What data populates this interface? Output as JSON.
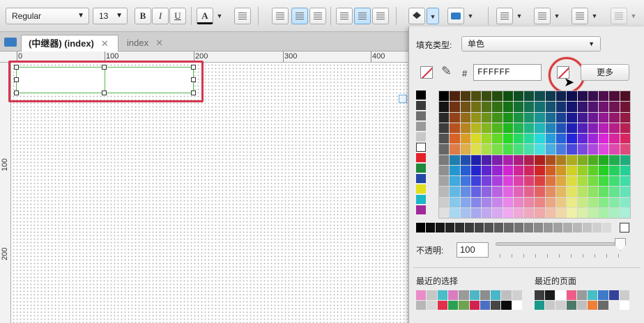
{
  "toolbar": {
    "font_family": "Regular",
    "font_size": "13",
    "bold": "B",
    "italic": "I",
    "underline": "U",
    "font_color": "A"
  },
  "tabs": [
    {
      "label": "(中继器) (index)",
      "active": true
    },
    {
      "label": "index",
      "active": false
    }
  ],
  "ruler": {
    "h_labels": [
      "0",
      "100",
      "200",
      "300",
      "400"
    ],
    "v_labels": [
      "100",
      "200"
    ]
  },
  "fill_panel": {
    "fill_type_label": "填充类型:",
    "fill_type_value": "单色",
    "hex_prefix": "#",
    "hex_value": "FFFFFF",
    "more_button": "更多",
    "opacity_label": "不透明:",
    "opacity_value": "100",
    "recent_selection_label": "最近的选择",
    "recent_page_label": "最近的页面",
    "colors": {
      "grays": [
        "#000000",
        "#3a3a3a",
        "#6e6e6e",
        "#9a9a9a",
        "#c8c8c8",
        "#ffffff"
      ],
      "primaries": [
        "#e4202a",
        "#1f8a3b",
        "#2348a8",
        "#e3df1a",
        "#1ab7c9",
        "#a0299b"
      ],
      "recent_selection": [
        "#e98dc9",
        "#c6c6c6",
        "#48bfc6",
        "#d97dc1",
        "#9a9a9a",
        "#4fb6c7",
        "#8d8d8d",
        "#47b7c9",
        "#bfbfbf",
        "#d0d0d0",
        "#b7b7b7",
        "#d8d8d8",
        "#e1304a",
        "#2aa152",
        "#6fa34e",
        "#d2224e",
        "#4a6fc4",
        "#464646",
        "#0b0b0b",
        "#ffffff"
      ],
      "recent_page": [
        "#3d3d3d",
        "#1b1b1b",
        "#ffffff",
        "#ef5c8a",
        "#9a9a9a",
        "#48bfc6",
        "#3d7bc9",
        "#34439a",
        "#cccccc",
        "#1a9a8c",
        "#c9c9c9",
        "#cfcfcf",
        "#4b7a68",
        "#bfbfbf",
        "#f07f3a",
        "#6a6a6a",
        "#ececec",
        "#ffffff"
      ]
    }
  }
}
